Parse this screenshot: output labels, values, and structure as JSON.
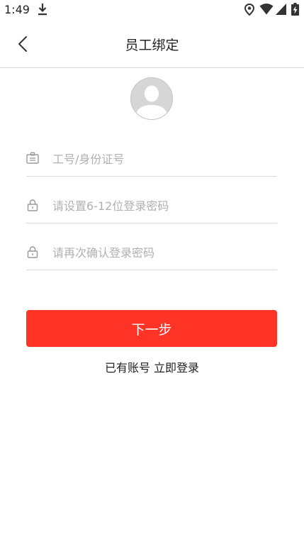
{
  "status_bar": {
    "time": "1:49",
    "icons": [
      "download-icon",
      "location-icon",
      "wifi-icon",
      "cellular-signal-icon",
      "battery-charging-icon"
    ]
  },
  "header": {
    "title": "员工绑定",
    "back_icon": "chevron-left-icon"
  },
  "avatar": {
    "icon": "default-avatar-icon"
  },
  "form": {
    "employee_id": {
      "value": "",
      "placeholder": "工号/身份证号",
      "icon": "id-card-icon"
    },
    "password": {
      "value": "",
      "placeholder": "请设置6-12位登录密码",
      "icon": "lock-icon"
    },
    "confirm_password": {
      "value": "",
      "placeholder": "请再次确认登录密码",
      "icon": "lock-icon"
    }
  },
  "actions": {
    "next_label": "下一步",
    "has_account_text": "已有账号",
    "login_now_label": "立即登录"
  },
  "colors": {
    "primary": "#ff3326",
    "placeholder": "#b0b0b0",
    "divider": "#dcdcdc"
  }
}
